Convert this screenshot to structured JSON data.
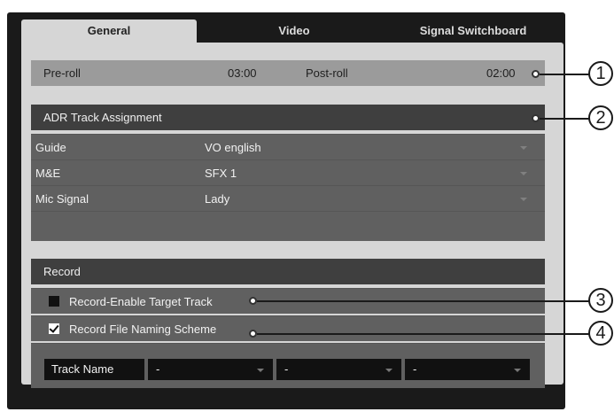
{
  "tabs": [
    {
      "label": "General",
      "active": true
    },
    {
      "label": "Video",
      "active": false
    },
    {
      "label": "Signal Switchboard",
      "active": false
    }
  ],
  "preroll": {
    "pre_label": "Pre-roll",
    "pre_value": "03:00",
    "post_label": "Post-roll",
    "post_value": "02:00"
  },
  "adr": {
    "header": "ADR Track Assignment",
    "rows": [
      {
        "label": "Guide",
        "value": "VO english"
      },
      {
        "label": "M&E",
        "value": "SFX 1"
      },
      {
        "label": "Mic Signal",
        "value": "Lady"
      }
    ]
  },
  "record": {
    "header": "Record",
    "enable_target": {
      "label": "Record-Enable Target Track",
      "checked": false
    },
    "naming_scheme": {
      "label": "Record File Naming Scheme",
      "checked": true
    },
    "track_name_label": "Track Name",
    "naming_fields": [
      "-",
      "-",
      "-"
    ]
  },
  "callouts": [
    "1",
    "2",
    "3",
    "4"
  ]
}
